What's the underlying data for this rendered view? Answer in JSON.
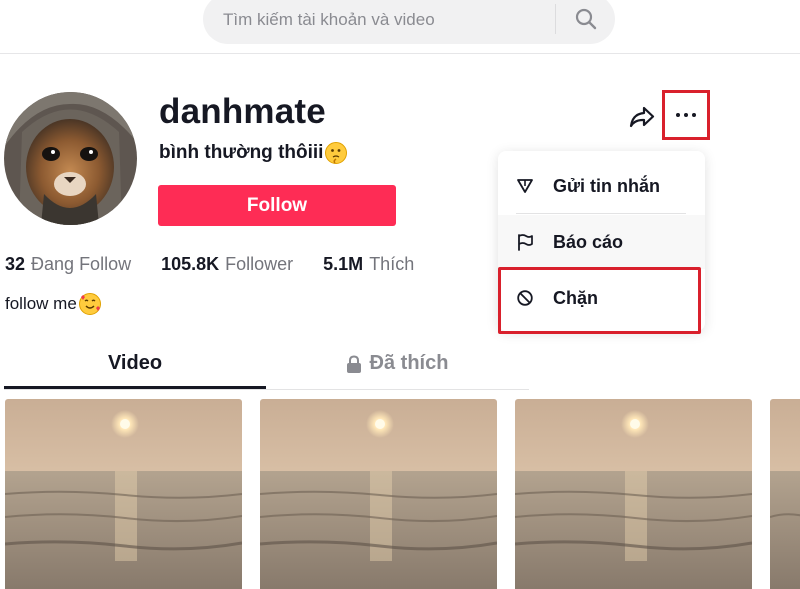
{
  "search": {
    "placeholder": "Tìm kiếm tài khoản và video"
  },
  "profile": {
    "username": "danhmate",
    "nickname": "bình thường thôiii",
    "follow_label": "Follow",
    "bio": "follow me"
  },
  "stats": [
    {
      "value": "32",
      "label": "Đang Follow"
    },
    {
      "value": "105.8K",
      "label": "Follower"
    },
    {
      "value": "5.1M",
      "label": "Thích"
    }
  ],
  "menu": {
    "items": [
      {
        "label": "Gửi tin nhắn",
        "icon": "send-icon"
      },
      {
        "label": "Báo cáo",
        "icon": "flag-icon"
      },
      {
        "label": "Chặn",
        "icon": "block-icon"
      }
    ]
  },
  "tabs": [
    {
      "label": "Video",
      "active": true
    },
    {
      "label": "Đã thích",
      "active": false,
      "icon": "lock-icon"
    }
  ],
  "colors": {
    "accent": "#fe2c55",
    "highlight": "#d9202c",
    "text": "#161823",
    "muted": "#73747b"
  }
}
